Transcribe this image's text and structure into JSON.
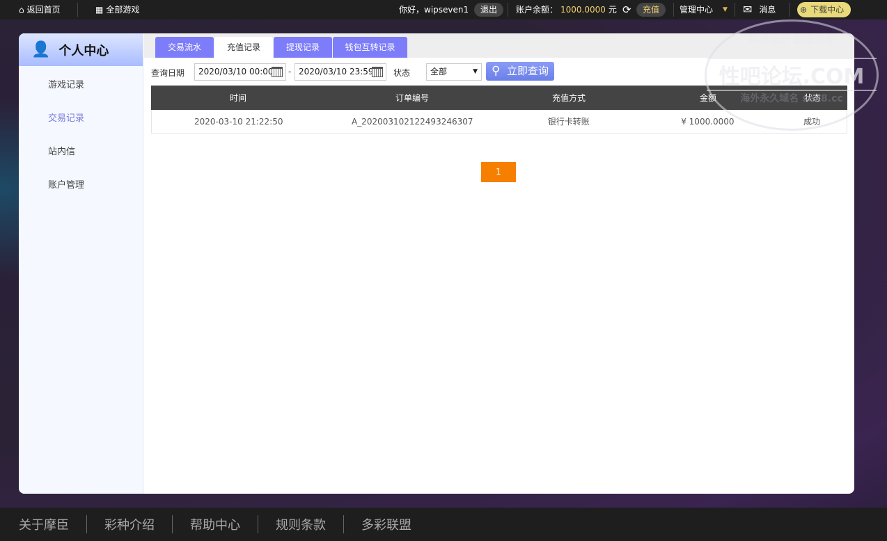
{
  "topbar": {
    "home": "返回首页",
    "all_games": "全部游戏",
    "greeting": "你好，wipseven1",
    "logout": "退出",
    "balance_label": "账户余额：",
    "balance": "1000.0000",
    "currency": "元",
    "recharge": "充值",
    "manage": "管理中心",
    "messages": "消息",
    "download": "下载中心"
  },
  "sidebar": {
    "title": "个人中心",
    "items": [
      {
        "label": "游戏记录"
      },
      {
        "label": "交易记录"
      },
      {
        "label": "站内信"
      },
      {
        "label": "账户管理"
      }
    ],
    "active_color": "#7b7be0"
  },
  "tabs": [
    {
      "label": "交易流水"
    },
    {
      "label": "充值记录"
    },
    {
      "label": "提现记录"
    },
    {
      "label": "钱包互转记录"
    }
  ],
  "filter": {
    "date_label": "查询日期",
    "start": "2020/03/10 00:00",
    "dash": "-",
    "end": "2020/03/10 23:59",
    "status_label": "状态",
    "status_value": "全部",
    "search": "立即查询"
  },
  "table": {
    "headers": [
      "时间",
      "订单编号",
      "充值方式",
      "金额",
      "状态"
    ],
    "rows": [
      [
        "2020-03-10 21:22:50",
        "A_202003102122493246307",
        "银行卡转账",
        "¥ 1000.0000",
        "成功"
      ]
    ]
  },
  "pagination": {
    "current": "1"
  },
  "footer": [
    "关于摩臣",
    "彩种介绍",
    "帮助中心",
    "规则条款",
    "多彩联盟"
  ],
  "watermark": {
    "top": "春暖花开 香吧有你",
    "main": "性吧论坛.COM",
    "bottom": "海外永久域名 sex8.cc"
  }
}
